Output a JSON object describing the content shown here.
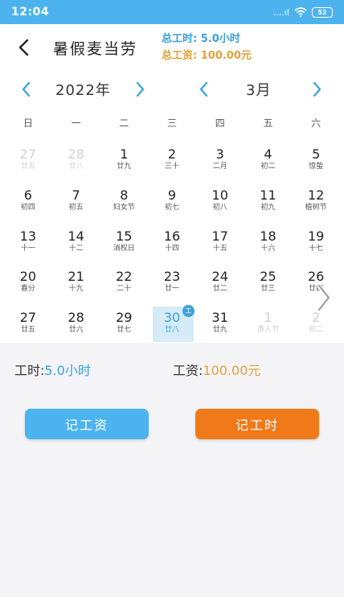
{
  "status_bar": {
    "time": "12:04",
    "signal": "....ıl",
    "battery": "52"
  },
  "header": {
    "title": "暑假麦当劳",
    "total_hours": "总工时: 5.0小时",
    "total_wage": "总工资: 100.00元"
  },
  "calendar": {
    "year_label": "2022年",
    "month_label": "3月",
    "weekdays": [
      "日",
      "一",
      "二",
      "三",
      "四",
      "五",
      "六"
    ],
    "weeks": [
      [
        {
          "n": "27",
          "l": "廿五",
          "o": true
        },
        {
          "n": "28",
          "l": "廿八",
          "o": true
        },
        {
          "n": "1",
          "l": "廿九"
        },
        {
          "n": "2",
          "l": "三十"
        },
        {
          "n": "3",
          "l": "二月"
        },
        {
          "n": "4",
          "l": "初二"
        },
        {
          "n": "5",
          "l": "惊蛰"
        }
      ],
      [
        {
          "n": "6",
          "l": "初四"
        },
        {
          "n": "7",
          "l": "初五"
        },
        {
          "n": "8",
          "l": "妇女节"
        },
        {
          "n": "9",
          "l": "初七"
        },
        {
          "n": "10",
          "l": "初八"
        },
        {
          "n": "11",
          "l": "初九"
        },
        {
          "n": "12",
          "l": "植树节"
        }
      ],
      [
        {
          "n": "13",
          "l": "十一"
        },
        {
          "n": "14",
          "l": "十二"
        },
        {
          "n": "15",
          "l": "消权日"
        },
        {
          "n": "16",
          "l": "十四"
        },
        {
          "n": "17",
          "l": "十五"
        },
        {
          "n": "18",
          "l": "十六"
        },
        {
          "n": "19",
          "l": "十七"
        }
      ],
      [
        {
          "n": "20",
          "l": "春分"
        },
        {
          "n": "21",
          "l": "十九"
        },
        {
          "n": "22",
          "l": "二十"
        },
        {
          "n": "23",
          "l": "廿一"
        },
        {
          "n": "24",
          "l": "廿二"
        },
        {
          "n": "25",
          "l": "廿三"
        },
        {
          "n": "26",
          "l": "廿四"
        }
      ],
      [
        {
          "n": "27",
          "l": "廿五"
        },
        {
          "n": "28",
          "l": "廿六"
        },
        {
          "n": "29",
          "l": "廿七"
        },
        {
          "n": "30",
          "l": "廿八",
          "s": true,
          "badge": "工"
        },
        {
          "n": "31",
          "l": "廿九"
        },
        {
          "n": "1",
          "l": "愚人节",
          "o": true
        },
        {
          "n": "2",
          "l": "初二",
          "o": true
        }
      ]
    ]
  },
  "summary": {
    "hours_label": "工时:",
    "hours_value": "5.0小时",
    "wage_label": "工资:",
    "wage_value": "100.00元"
  },
  "buttons": {
    "record_wage": "记工资",
    "record_hours": "记工时"
  },
  "colors": {
    "accent_blue": "#4db3ee",
    "accent_orange": "#f07a1a",
    "wage_gold": "#e0a23a"
  }
}
